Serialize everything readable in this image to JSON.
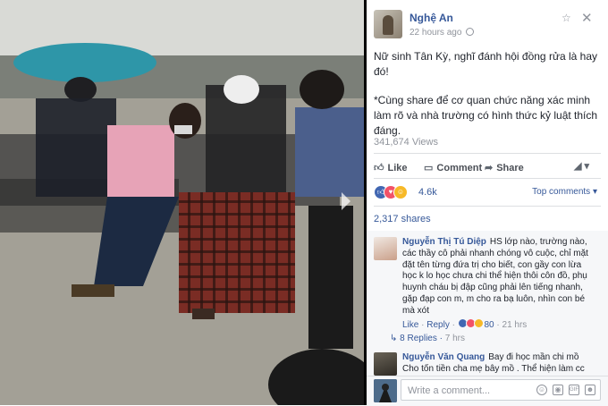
{
  "post": {
    "page_name": "Nghệ An",
    "timestamp": "22 hours ago",
    "text_1": "Nữ sinh Tân Kỳ, nghĩ đánh hội đồng rửa là hay đó!",
    "text_2": "*Cùng share để cơ quan chức năng xác minh làm rõ và nhà trường có hình thức kỷ luật thích đáng.",
    "views": "341,674 Views"
  },
  "actions": {
    "like": "Like",
    "comment": "Comment",
    "share": "Share"
  },
  "reactions": {
    "count": "4.6k",
    "top_comments": "Top comments",
    "shares": "2,317 shares"
  },
  "comments": [
    {
      "name": "Nguyễn Thị Tú Diệp",
      "text": "HS lớp nào, trường nào, các thầy cô phải nhanh chóng vô cuộc, chỉ mặt đặt tên từng đứa trị cho biết, con gầy con lừa học k lo học chưa chi thể hiện thôi côn đồ, phụ huynh cháu bị đập cũng phải lên tiếng nhanh, gặp đạp con m, m cho ra bạ luôn, nhìn con bé mà xót",
      "like": "Like",
      "reply": "Reply",
      "reaction_count": "80",
      "time": "21 hrs",
      "replies": "8 Replies",
      "replies_time": "7 hrs"
    },
    {
      "name": "Nguyễn Văn Quang",
      "text": "Bay đi học mần chi mồ Cho tốn tiền cha mẹ bây mồ . Thể hiện làm cc"
    }
  ],
  "composer": {
    "placeholder": "Write a comment..."
  },
  "colors": {
    "link": "#365899",
    "meta": "#90949c",
    "like_blue": "#4267b2",
    "love_red": "#f25268",
    "haha_yellow": "#f7b928"
  },
  "icons": [
    "globe-icon",
    "star-icon",
    "close-icon",
    "like-icon",
    "comment-icon",
    "share-icon",
    "more-icon",
    "camera-icon",
    "gif-icon",
    "sticker-icon",
    "emoji-icon"
  ]
}
